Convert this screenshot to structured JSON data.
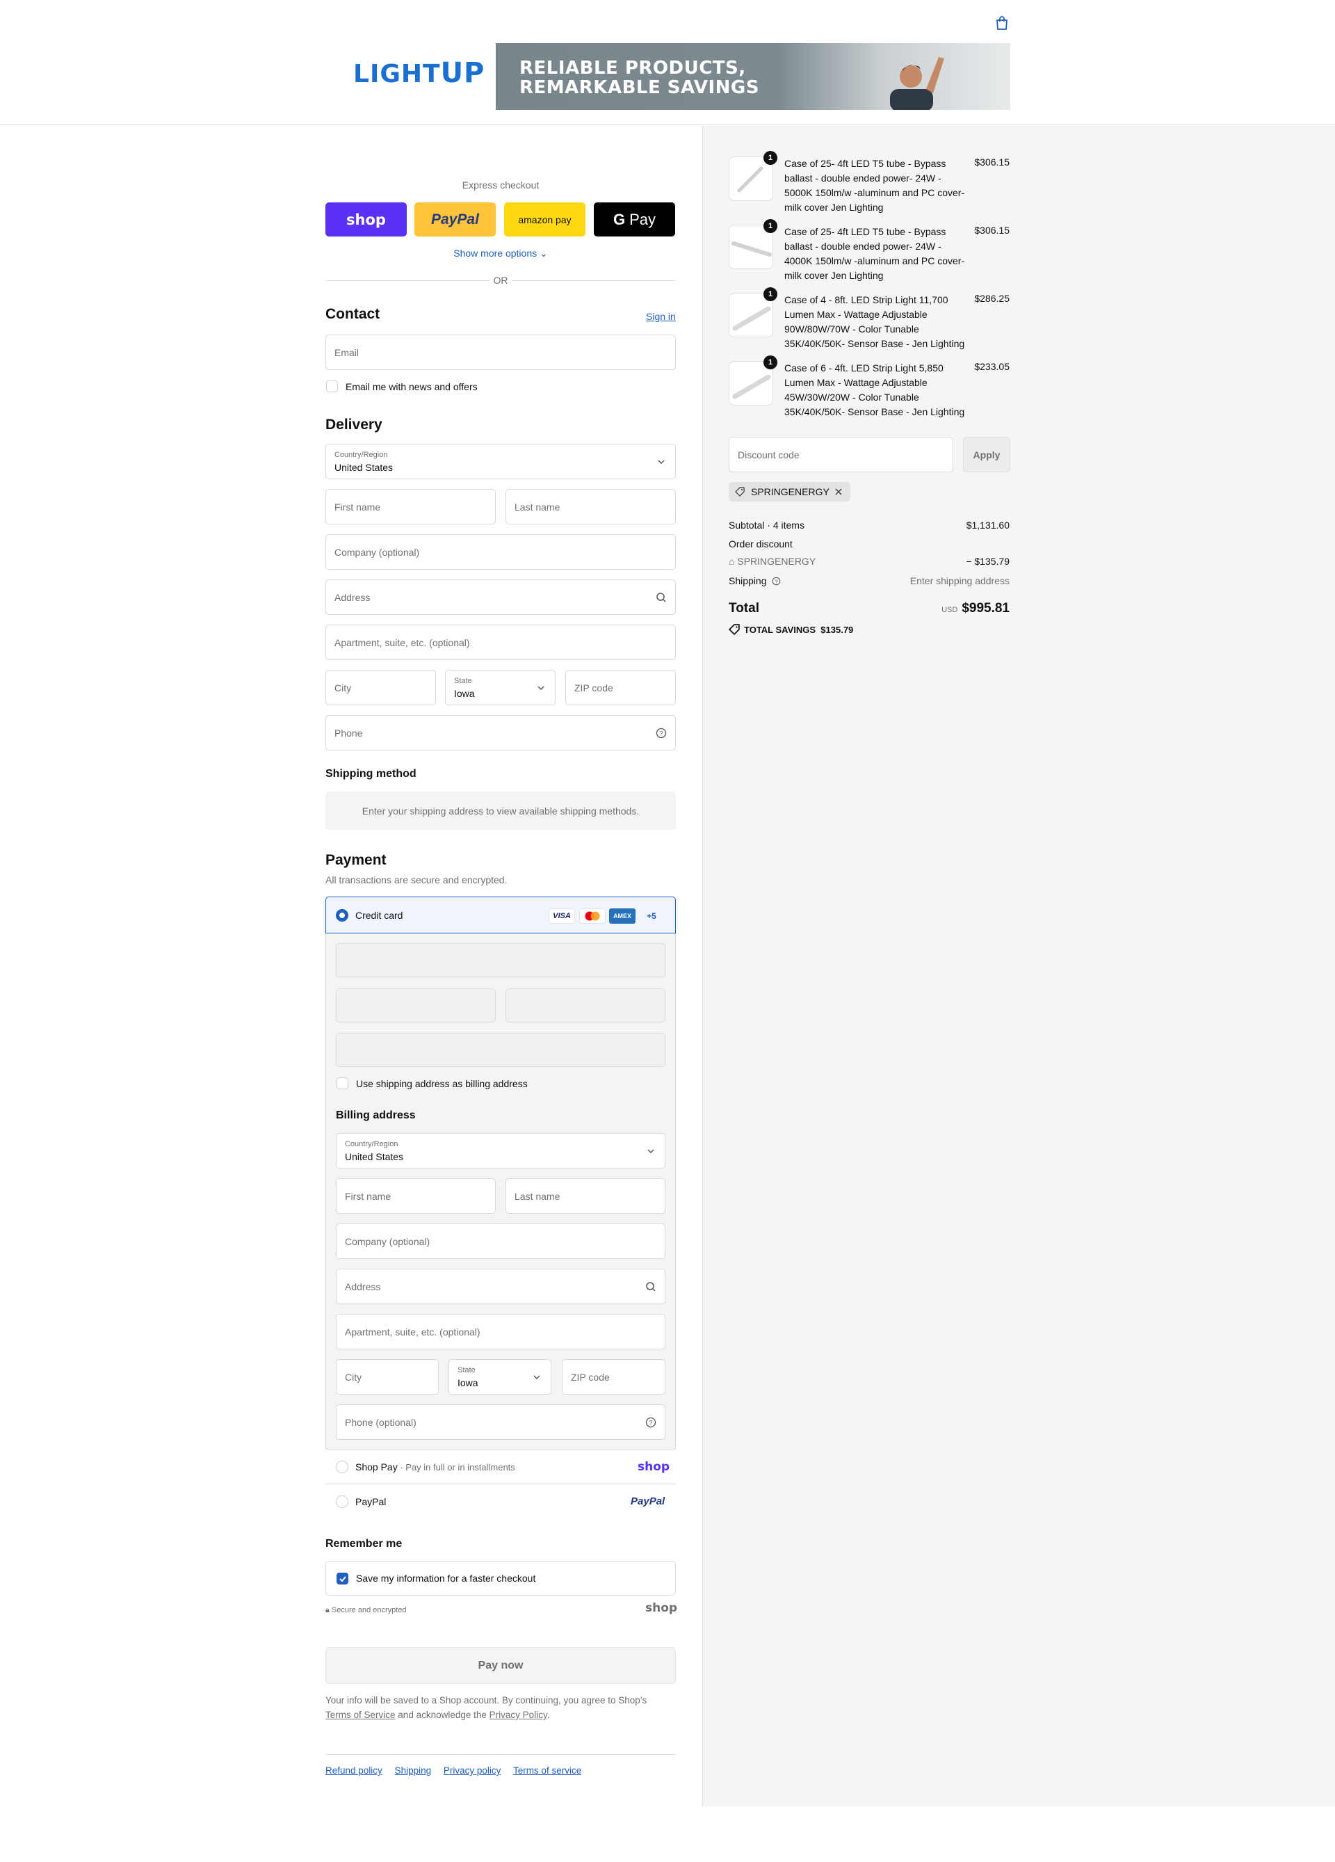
{
  "header": {
    "logo": {
      "light": "LIGHT",
      "up": "UP"
    },
    "banner": {
      "line1": "RELIABLE PRODUCTS,",
      "line2": "REMARKABLE SAVINGS"
    }
  },
  "express": {
    "label": "Express checkout",
    "shop": "shop",
    "paypal": "PayPal",
    "amazon": "amazon pay",
    "gpay": "Pay",
    "more": "Show more options",
    "or": "OR"
  },
  "contact": {
    "title": "Contact",
    "signin": "Sign in",
    "email_placeholder": "Email",
    "news": "Email me with news and offers"
  },
  "delivery": {
    "title": "Delivery",
    "country_label": "Country/Region",
    "country": "United States",
    "first": "First name",
    "last": "Last name",
    "company": "Company (optional)",
    "address": "Address",
    "apartment": "Apartment, suite, etc. (optional)",
    "city": "City",
    "state_label": "State",
    "state": "Iowa",
    "zip": "ZIP code",
    "phone": "Phone"
  },
  "shipping_method": {
    "title": "Shipping method",
    "notice": "Enter your shipping address to view available shipping methods."
  },
  "payment": {
    "title": "Payment",
    "subtitle": "All transactions are secure and encrypted.",
    "credit_card": "Credit card",
    "cards": {
      "visa": "VISA",
      "amex": "AMEX",
      "more": "+5"
    },
    "use_shipping": "Use shipping address as billing address",
    "billing_title": "Billing address",
    "billing": {
      "country_label": "Country/Region",
      "country": "United States",
      "first": "First name",
      "last": "Last name",
      "company": "Company (optional)",
      "address": "Address",
      "apartment": "Apartment, suite, etc. (optional)",
      "city": "City",
      "state_label": "State",
      "state": "Iowa",
      "zip": "ZIP code",
      "phone": "Phone (optional)"
    },
    "shoppay": "Shop Pay",
    "shoppay_sub": "Pay in full or in installments",
    "shoppay_logo": "shop",
    "paypal": "PayPal",
    "paypal_logo": "PayPal"
  },
  "remember": {
    "title": "Remember me",
    "save": "Save my information for a faster checkout",
    "secure": "Secure and encrypted",
    "shop_logo": "shop"
  },
  "pay_now": "Pay now",
  "legal": {
    "line1": "Your info will be saved to a Shop account. By continuing, you agree to Shop’s",
    "tos": "Terms of Service",
    "mid": "and acknowledge the",
    "privacy": "Privacy Policy",
    "end": "."
  },
  "footer": {
    "refund": "Refund policy",
    "shipping": "Shipping",
    "privacy": "Privacy policy",
    "terms": "Terms of service"
  },
  "order": {
    "items": [
      {
        "qty": "1",
        "name": "Case of 25- 4ft LED T5 tube - Bypass ballast - double ended power- 24W - 5000K 150lm/w -aluminum and PC cover- milk cover Jen Lighting",
        "price": "$306.15"
      },
      {
        "qty": "1",
        "name": "Case of 25- 4ft LED T5 tube - Bypass ballast - double ended power- 24W - 4000K 150lm/w -aluminum and PC cover- milk cover Jen Lighting",
        "price": "$306.15"
      },
      {
        "qty": "1",
        "name": "Case of 4 - 8ft. LED Strip Light 11,700 Lumen Max - Wattage Adjustable 90W/80W/70W - Color Tunable 35K/40K/50K- Sensor Base - Jen Lighting",
        "price": "$286.25"
      },
      {
        "qty": "1",
        "name": "Case of 6 - 4ft. LED Strip Light 5,850 Lumen Max - Wattage Adjustable 45W/30W/20W - Color Tunable 35K/40K/50K- Sensor Base - Jen Lighting",
        "price": "$233.05"
      }
    ],
    "discount_placeholder": "Discount code",
    "apply": "Apply",
    "code": "SPRINGENERGY",
    "subtotal_label": "Subtotal · 4 items",
    "subtotal": "$1,131.60",
    "order_discount": "Order discount",
    "discount_code": "SPRINGENERGY",
    "discount_amount": "− $135.79",
    "shipping_label": "Shipping",
    "shipping_value": "Enter shipping address",
    "total_label": "Total",
    "currency": "USD",
    "total": "$995.81",
    "savings_label": "TOTAL SAVINGS",
    "savings": "$135.79"
  },
  "colors": {
    "accent": "#1e5fbf",
    "shop": "#5a31f4",
    "paypal_yellow": "#ffc439",
    "amazon_yellow": "#ffd814"
  }
}
